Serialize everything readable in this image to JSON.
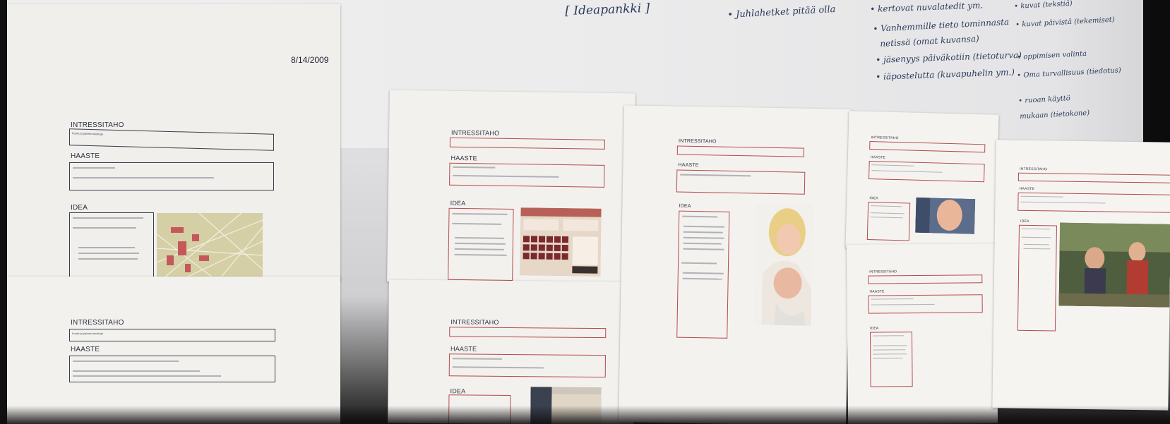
{
  "whiteboard": {
    "notes": [
      "[ Ideapankki ]",
      "• Juhlahetket pitää olla",
      "• kertovat nuvalatedit ym.",
      "• Vanhemmille tieto tominnasta",
      "netissä (omat kuvansa)",
      "• jäsenyys päiväkotiin (tietoturva)",
      "• iäpostelutta (kuvapuhelin ym.)",
      "• kuvat (tekstiä)",
      "• kuvat päivistä (tekemiset)",
      "• oppimisen valinta",
      "• Oma turvallisuus (tiedotus)",
      "• ruoan käyttö",
      "mukaan (tietokone)"
    ]
  },
  "sheets": {
    "date": "8/14/2009",
    "stakeholder_label": "INTRESSITAHO",
    "challenge_label": "HAASTE",
    "idea_label": "IDEA",
    "stakeholder_value": "Kunta ja palveluntuottaja"
  },
  "colors": {
    "paper": "#f3f1ee",
    "red_outline": "#b44a4e",
    "dark_outline": "#3a3d4a",
    "ink": "#2d3b5c"
  }
}
